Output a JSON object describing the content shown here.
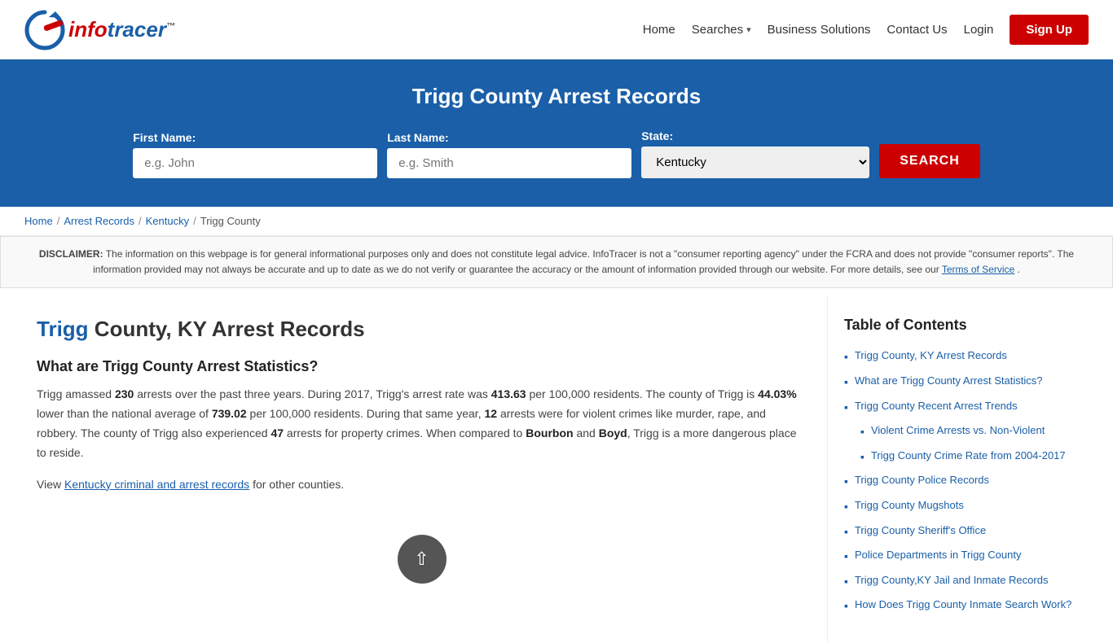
{
  "header": {
    "logo_info": "info",
    "logo_tracer": "tracer",
    "logo_tm": "™",
    "nav": {
      "home": "Home",
      "searches": "Searches",
      "business_solutions": "Business Solutions",
      "contact_us": "Contact Us",
      "login": "Login",
      "signup": "Sign Up"
    }
  },
  "hero": {
    "title": "Trigg County Arrest Records",
    "first_name_label": "First Name:",
    "first_name_placeholder": "e.g. John",
    "last_name_label": "Last Name:",
    "last_name_placeholder": "e.g. Smith",
    "state_label": "State:",
    "state_value": "Kentucky",
    "search_button": "SEARCH"
  },
  "breadcrumb": {
    "home": "Home",
    "arrest_records": "Arrest Records",
    "kentucky": "Kentucky",
    "trigg_county": "Trigg County"
  },
  "disclaimer": {
    "label": "DISCLAIMER:",
    "text": " The information on this webpage is for general informational purposes only and does not constitute legal advice. InfoTracer is not a \"consumer reporting agency\" under the FCRA and does not provide \"consumer reports\". The information provided may not always be accurate and up to date as we do not verify or guarantee the accuracy or the amount of information provided through our website. For more details, see our ",
    "link_text": "Terms of Service",
    "text_end": "."
  },
  "article": {
    "title_highlight": "Trigg",
    "title_rest": " County, KY Arrest Records",
    "section1_heading": "What are Trigg County Arrest Statistics?",
    "section1_p1_start": "Trigg amassed ",
    "section1_p1_arrests": "230",
    "section1_p1_mid1": " arrests over the past three years. During 2017, Trigg's arrest rate was ",
    "section1_p1_rate": "413.63",
    "section1_p1_mid2": " per 100,000 residents. The county of Trigg is ",
    "section1_p1_pct": "44.03%",
    "section1_p1_mid3": " lower than the national average of ",
    "section1_p1_national": "739.02",
    "section1_p1_end": " per 100,000 residents. During that same year, ",
    "section1_p1_violent": "12",
    "section1_p1_mid4": " arrests were for violent crimes like murder, rape, and robbery. The county of Trigg also experienced ",
    "section1_p1_property": "47",
    "section1_p1_mid5": " arrests for property crimes. When compared to ",
    "section1_p1_b1": "Bourbon",
    "section1_p1_and": " and ",
    "section1_p1_b2": "Boyd",
    "section1_p1_end2": ", Trigg is a more dangerous place to reside.",
    "section1_p2_start": "View ",
    "section1_p2_link": "Kentucky criminal and arrest records",
    "section1_p2_end": " for other counties."
  },
  "toc": {
    "heading": "Table of Contents",
    "items": [
      {
        "text": "Trigg County, KY Arrest Records"
      },
      {
        "text": "What are Trigg County Arrest Statistics?"
      },
      {
        "text": "Trigg County Recent Arrest Trends"
      },
      {
        "text": "Violent Crime Arrests vs. Non-Violent",
        "sub": true
      },
      {
        "text": "Trigg County Crime Rate from 2004-2017",
        "sub": true
      },
      {
        "text": "Trigg County Police Records"
      },
      {
        "text": "Trigg County Mugshots"
      },
      {
        "text": "Trigg County Sheriff's Office"
      },
      {
        "text": "Police Departments in Trigg County"
      },
      {
        "text": "Trigg County,KY Jail and Inmate Records"
      },
      {
        "text": "How Does Trigg County Inmate Search Work?"
      }
    ]
  },
  "colors": {
    "brand_blue": "#1a5fa8",
    "brand_red": "#cc0000"
  }
}
